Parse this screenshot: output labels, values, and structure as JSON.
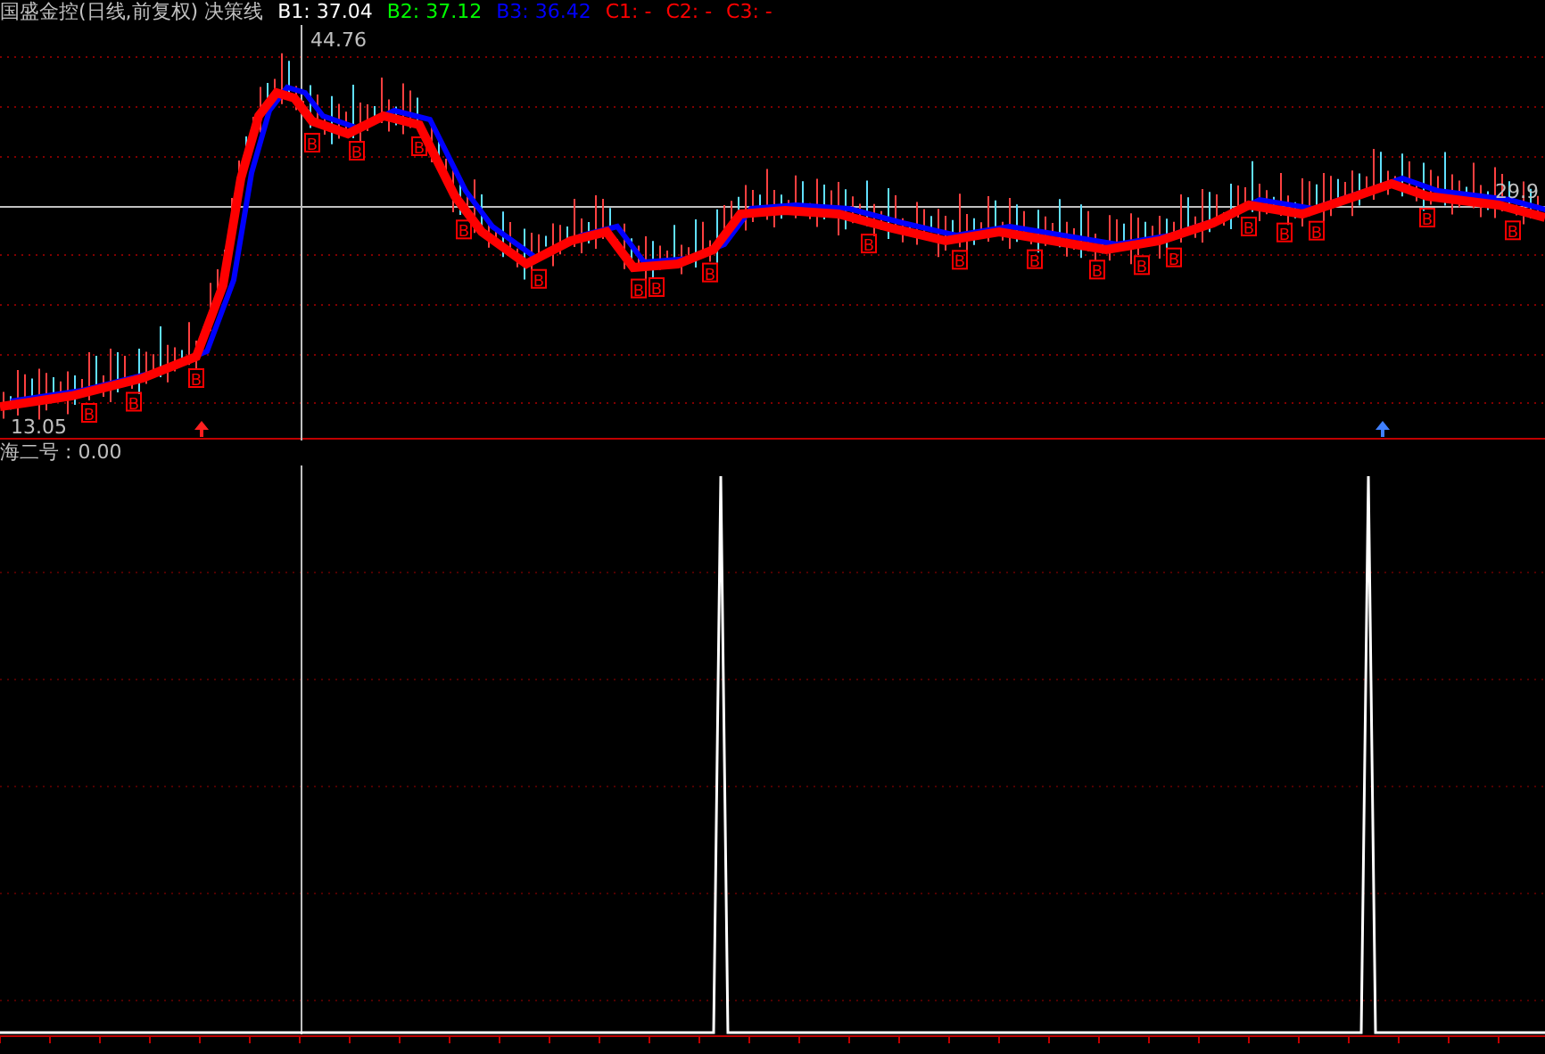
{
  "header": {
    "title": "国盛金控(日线,前复权) 决策线",
    "values": [
      {
        "label": "B1: 37.04",
        "color": "#ffffff"
      },
      {
        "label": "B2: 37.12",
        "color": "#00ff00"
      },
      {
        "label": "B3: 36.42",
        "color": "#0000ff"
      },
      {
        "label": "C1: -",
        "color": "#ff0000"
      },
      {
        "label": "C2: -",
        "color": "#ff0000"
      },
      {
        "label": "C3: -",
        "color": "#ff0000"
      }
    ]
  },
  "price_panel": {
    "high_label": "44.76",
    "low_label": "13.05",
    "last_price_label": "29.9",
    "buy_marks": [
      {
        "label": "B"
      },
      {
        "label": "B"
      },
      {
        "label": "B"
      },
      {
        "label": "B"
      },
      {
        "label": "B"
      },
      {
        "label": "B"
      },
      {
        "label": "B"
      },
      {
        "label": "B"
      },
      {
        "label": "B"
      },
      {
        "label": "B"
      },
      {
        "label": "B"
      },
      {
        "label": "B"
      },
      {
        "label": "B"
      },
      {
        "label": "B"
      },
      {
        "label": "B"
      },
      {
        "label": "B"
      },
      {
        "label": "B"
      },
      {
        "label": "B"
      },
      {
        "label": "B"
      },
      {
        "label": "B"
      },
      {
        "label": "B"
      },
      {
        "label": "B"
      }
    ]
  },
  "indicator_panel": {
    "title": "海二号 : 0.00"
  }
}
